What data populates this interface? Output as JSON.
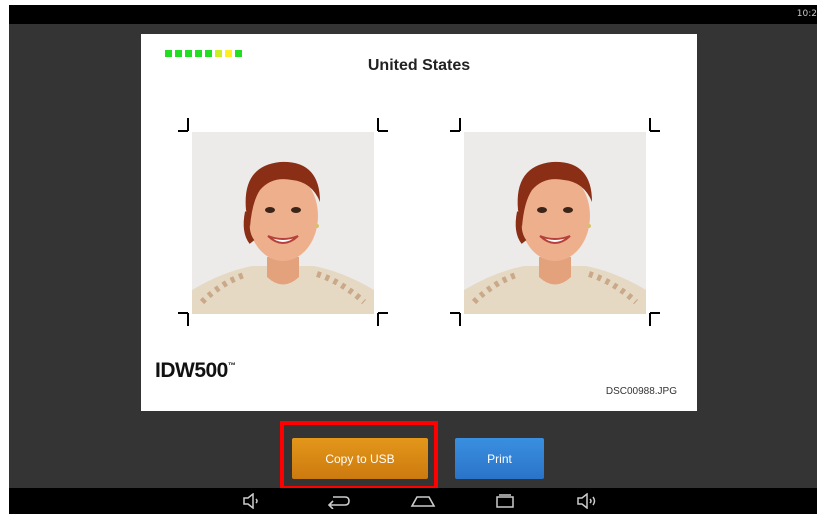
{
  "status_bar": {
    "time": "10:2"
  },
  "preview": {
    "quality_colors": [
      "#22dd22",
      "#22dd22",
      "#22dd22",
      "#22dd22",
      "#22dd22",
      "#ccee22",
      "#ffee22",
      "#22dd22"
    ],
    "country": "United States",
    "brand": "IDW500",
    "brand_tm": "™",
    "filename": "DSC00988.JPG"
  },
  "actions": {
    "copy_label": "Copy to USB",
    "print_label": "Print"
  },
  "colors": {
    "copy_button": "#d8861a",
    "print_button": "#3380d6",
    "highlight": "#ff0000"
  },
  "nav": {
    "icons": [
      "volume-down-icon",
      "back-icon",
      "home-icon",
      "recents-icon",
      "volume-up-icon"
    ]
  }
}
